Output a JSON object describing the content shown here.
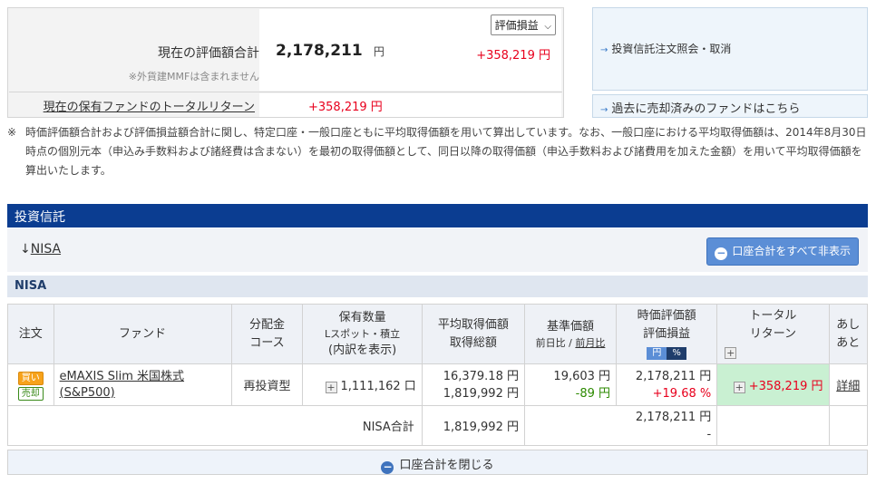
{
  "summary": {
    "eval_label": "現在の評価額合計",
    "mmf_note": "※外貨建MMFは含まれません",
    "total_amount": "2,178,211",
    "yen": "円",
    "select_value": "評価損益",
    "gain": "+358,219 円",
    "return_link": "現在の保有ファンドのトータルリターン",
    "return_value": "+358,219 円"
  },
  "right_links": {
    "order_inquiry": "投資信託注文照会・取消",
    "sold_funds": "過去に売却済みのファンドはこちら"
  },
  "note": {
    "mark": "※",
    "text": "時価評価額合計および評価損益額合計に関し、特定口座・一般口座ともに平均取得価額を用いて算出しています。なお、一般口座における平均取得価額は、2014年8月30日時点の個別元本（申込み手数料および諸経費は含まない）を最初の取得価額として、同日以降の取得価額（申込手数料および諸費用を加えた金額）を用いて平均取得価額を算出いたします。"
  },
  "section": {
    "title": "投資信託",
    "nisa_link": "NISA",
    "hide_all_button": "口座合計をすべて非表示",
    "nisa_bar": "NISA"
  },
  "table": {
    "headers": {
      "order": "注文",
      "fund": "ファンド",
      "dist_1": "分配金",
      "dist_2": "コース",
      "qty_1": "保有数量",
      "qty_sub": "Lスポット・積立",
      "qty_detail": "(内訳を表示)",
      "avg_1": "平均取得価額",
      "avg_2": "取得総額",
      "base_1": "基準価額",
      "base_sub_a": "前日比",
      "base_sub_sep": "/",
      "base_sub_b": "前月比",
      "eval_1": "時価評価額",
      "eval_2": "評価損益",
      "toggle_yen": "円",
      "toggle_pct": "%",
      "total_1": "トータル",
      "total_2": "リターン",
      "ashi_1": "あし",
      "ashi_2": "あと"
    },
    "row": {
      "buy": "買い",
      "sell": "売却",
      "fund_name": "eMAXIS Slim 米国株式 (S&P500)",
      "dist_course": "再投資型",
      "quantity": "1,111,162 口",
      "avg_price": "16,379.18 円",
      "total_cost": "1,819,992 円",
      "base_price": "19,603 円",
      "base_change": "-89 円",
      "market_value": "2,178,211 円",
      "gain_pct": "+19.68 %",
      "total_return": "+358,219 円",
      "detail_link": "詳細"
    },
    "subtotal": {
      "label": "NISA合計",
      "total_cost": "1,819,992 円",
      "market_value": "2,178,211 円",
      "gain": "-"
    }
  },
  "close_bar": {
    "label": "口座合計を閉じる"
  }
}
